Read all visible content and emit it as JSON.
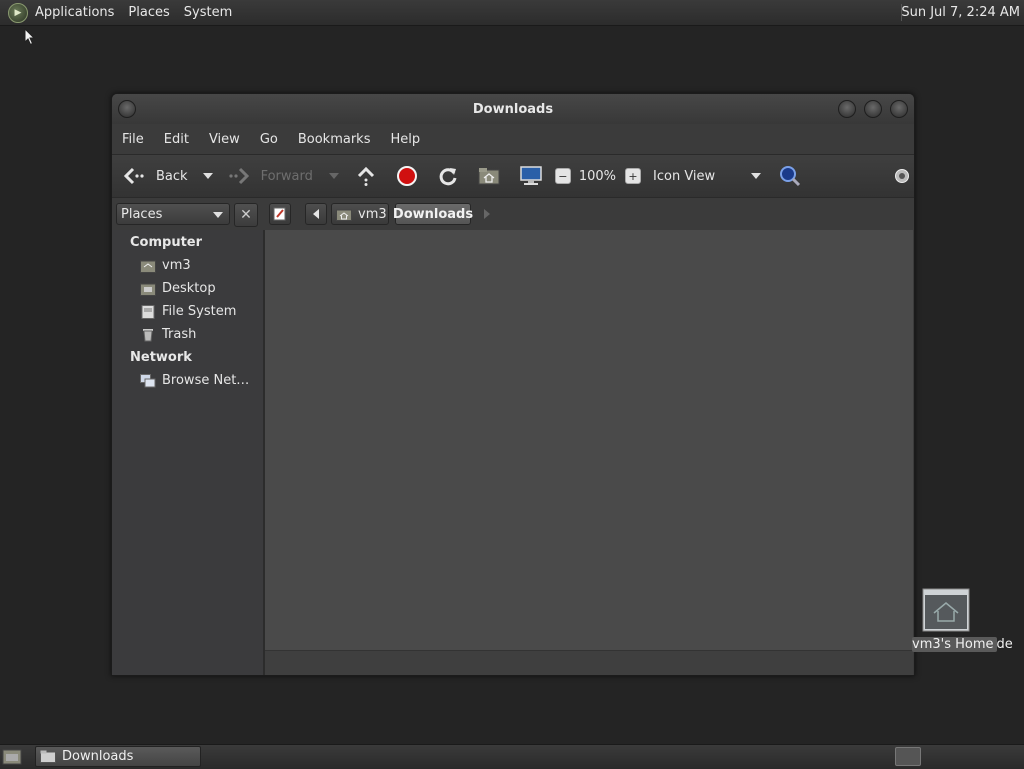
{
  "top_panel": {
    "menus": [
      "Applications",
      "Places",
      "System"
    ],
    "clock": "Sun Jul  7,  2:24 AM"
  },
  "window": {
    "title": "Downloads",
    "menubar": [
      "File",
      "Edit",
      "View",
      "Go",
      "Bookmarks",
      "Help"
    ],
    "toolbar": {
      "back": "Back",
      "forward": "Forward",
      "zoom": "100%",
      "view_mode": "Icon View"
    },
    "sidebar_selector": "Places",
    "breadcrumbs": [
      "vm3",
      "Downloads"
    ],
    "sidebar": {
      "computer_heading": "Computer",
      "computer_items": [
        "vm3",
        "Desktop",
        "File System",
        "Trash"
      ],
      "network_heading": "Network",
      "network_items": [
        "Browse Net…"
      ]
    }
  },
  "desktop": {
    "home_icon_label_highlight": "vm3's Home",
    "home_icon_label_rest": "de"
  },
  "bottom_panel": {
    "task": "Downloads"
  }
}
